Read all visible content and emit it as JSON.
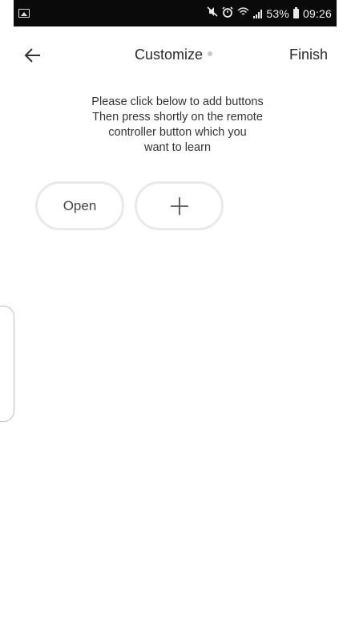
{
  "status_bar": {
    "battery_percent": "53%",
    "time": "09:26",
    "icons": [
      "gallery-icon",
      "mute-icon",
      "alarm-icon",
      "wifi-icon",
      "signal-icon",
      "battery-icon"
    ]
  },
  "header": {
    "back_icon": "arrow-left-icon",
    "title": "Customize",
    "finish_label": "Finish"
  },
  "instructions": {
    "lines": [
      "Please click below to add buttons",
      "Then press shortly on the remote",
      "controller button which you",
      "want to learn"
    ]
  },
  "buttons": {
    "items": [
      {
        "label": "Open"
      }
    ],
    "add_icon": "plus-icon"
  },
  "colors": {
    "background": "#ffffff",
    "status_bar": "#0a0a0a",
    "pill_border": "#e9e9e9",
    "text": "#2a2a2a"
  }
}
